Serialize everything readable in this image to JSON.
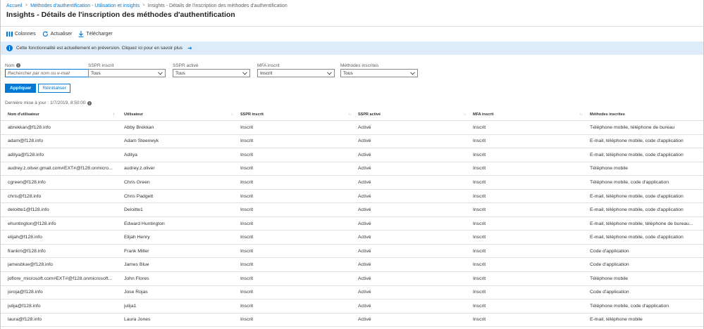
{
  "breadcrumb": {
    "items": [
      "Accueil",
      "Méthodes d'authentification - Utilisation et insights",
      "Insights - Détails de l'inscription des méthodes d'authentification"
    ]
  },
  "page": {
    "title": "Insights - Détails de l'inscription des méthodes d'authentification"
  },
  "toolbar": {
    "columns_label": "Colonnes",
    "refresh_label": "Actualiser",
    "download_label": "Télécharger"
  },
  "banner": {
    "text": "Cette fonctionnalité est actuellement en préversion. Cliquez ici pour en savoir plus",
    "arrow": "➔"
  },
  "filters": {
    "name_label": "Nom",
    "name_placeholder": "Rechercher par nom ou e-mail",
    "sspr_registered_label": "SSPR inscrit",
    "sspr_registered_value": "Tous",
    "sspr_enabled_label": "SSPR activé",
    "sspr_enabled_value": "Tous",
    "mfa_registered_label": "MFA inscrit",
    "mfa_registered_value": "Inscrit",
    "methods_label": "Méthodes inscrites",
    "methods_value": "Tous"
  },
  "actions": {
    "apply_label": "Appliquer",
    "reset_label": "Réinitialiser"
  },
  "last_updated": "Dernière mise à jour : 1/7/2019, 8:50:00",
  "table": {
    "columns": [
      "Nom d'utilisateur",
      "Utilisateur",
      "SSPR inscrit",
      "SSPR activé",
      "MFA inscrit",
      "Méthodes inscrites"
    ],
    "rows": [
      [
        "abrekkan@f128.info",
        "Abby Brekkan",
        "Inscrit",
        "Activé",
        "Inscrit",
        "Téléphone mobile, téléphone de bureau"
      ],
      [
        "adam@f128.info",
        "Adam Steenwyk",
        "Inscrit",
        "Activé",
        "Inscrit",
        "E-mail, téléphone mobile, code d'application"
      ],
      [
        "aditya@f128.info",
        "Aditya",
        "Inscrit",
        "Activé",
        "Inscrit",
        "E-mail, téléphone mobile, code d'application"
      ],
      [
        "audrey.z.oliver.gmail.com#EXT#@f128.onmicro...",
        "audrey.z.oliver",
        "Inscrit",
        "Activé",
        "Inscrit",
        "Téléphone mobile"
      ],
      [
        "cgreen@f128.info",
        "Chris Green",
        "Inscrit",
        "Activé",
        "Inscrit",
        "Téléphone mobile, code d'application"
      ],
      [
        "chris@f128.info",
        "Chris Padgett",
        "Inscrit",
        "Activé",
        "Inscrit",
        "E-mail, téléphone mobile, code d'application"
      ],
      [
        "deloitte1@f128.info",
        "Deloitte1",
        "Inscrit",
        "Activé",
        "Inscrit",
        "E-mail, téléphone mobile, code d'application"
      ],
      [
        "ehuntington@f128.info",
        "Edward Huntington",
        "Inscrit",
        "Activé",
        "Inscrit",
        "E-mail, téléphone mobile, téléphone de bureau..."
      ],
      [
        "elijah@f128.info",
        "Elijah Henry",
        "Inscrit",
        "Activé",
        "Inscrit",
        "E-mail, téléphone mobile, code d'application"
      ],
      [
        "frankm@f128.info",
        "Frank Miller",
        "Inscrit",
        "Activé",
        "Inscrit",
        "Code d'application"
      ],
      [
        "jamesblue@f128.info",
        "James Blue",
        "Inscrit",
        "Activé",
        "Inscrit",
        "Code d'application"
      ],
      [
        "joflore_microsoft.com#EXT#@f128.onmicrosoft...",
        "John Flores",
        "Inscrit",
        "Activé",
        "Inscrit",
        "Téléphone mobile"
      ],
      [
        "joroja@f128.info",
        "Jose Rojas",
        "Inscrit",
        "Activé",
        "Inscrit",
        "Code d'application"
      ],
      [
        "julija@f128.info",
        "julija1",
        "Inscrit",
        "Activé",
        "Inscrit",
        "Téléphone mobile, code d'application"
      ],
      [
        "laura@f128.info",
        "Laura Jones",
        "Inscrit",
        "Activé",
        "Inscrit",
        "E-mail, téléphone mobile"
      ]
    ]
  },
  "colors": {
    "accent": "#0078d4",
    "banner_bg": "#deecf9",
    "border": "#e1dfdd"
  }
}
